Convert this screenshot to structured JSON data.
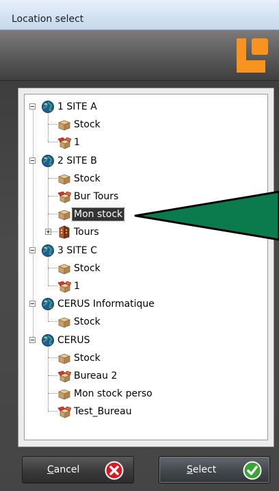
{
  "window": {
    "title": "Location select"
  },
  "tree": {
    "nodes": [
      {
        "label": "1 SITE A",
        "icon": "globe-icon",
        "level": 0,
        "expander": "minus",
        "last": false
      },
      {
        "label": "Stock",
        "icon": "box-icon",
        "level": 1,
        "last": false
      },
      {
        "label": "1",
        "icon": "open-box-icon",
        "level": 1,
        "last": true
      },
      {
        "label": "2 SITE B",
        "icon": "globe-icon",
        "level": 0,
        "expander": "minus",
        "last": false
      },
      {
        "label": "Stock",
        "icon": "box-icon",
        "level": 1,
        "last": false
      },
      {
        "label": "Bur Tours",
        "icon": "open-box-icon",
        "level": 1,
        "last": false
      },
      {
        "label": "Mon stock",
        "icon": "box-icon",
        "level": 1,
        "last": false,
        "selected": true
      },
      {
        "label": "Tours",
        "icon": "building-icon",
        "level": 1,
        "expander": "plus",
        "last": true
      },
      {
        "label": "3 SITE C",
        "icon": "globe-icon",
        "level": 0,
        "expander": "minus",
        "last": false
      },
      {
        "label": "Stock",
        "icon": "box-icon",
        "level": 1,
        "last": false
      },
      {
        "label": "1",
        "icon": "open-box-icon",
        "level": 1,
        "last": true
      },
      {
        "label": "CERUS Informatique",
        "icon": "globe-icon",
        "level": 0,
        "expander": "minus",
        "last": false
      },
      {
        "label": "Stock",
        "icon": "box-icon",
        "level": 1,
        "last": true
      },
      {
        "label": "CERUS",
        "icon": "globe-icon",
        "level": 0,
        "expander": "minus",
        "last": true
      },
      {
        "label": "Stock",
        "icon": "box-icon",
        "level": 1,
        "last": false
      },
      {
        "label": "Bureau 2",
        "icon": "open-box-icon",
        "level": 1,
        "last": false
      },
      {
        "label": "Mon stock perso",
        "icon": "box-icon",
        "level": 1,
        "last": false
      },
      {
        "label": "Test_Bureau",
        "icon": "open-box-icon",
        "level": 1,
        "last": true
      }
    ]
  },
  "buttons": {
    "cancel_label": "Cancel",
    "select_label": "Select"
  },
  "colors": {
    "accent_orange": "#f7931e",
    "selection": "#333333",
    "pointer_green": "#0b7a4c",
    "cancel_red": "#d71920",
    "select_green": "#3aa435"
  }
}
